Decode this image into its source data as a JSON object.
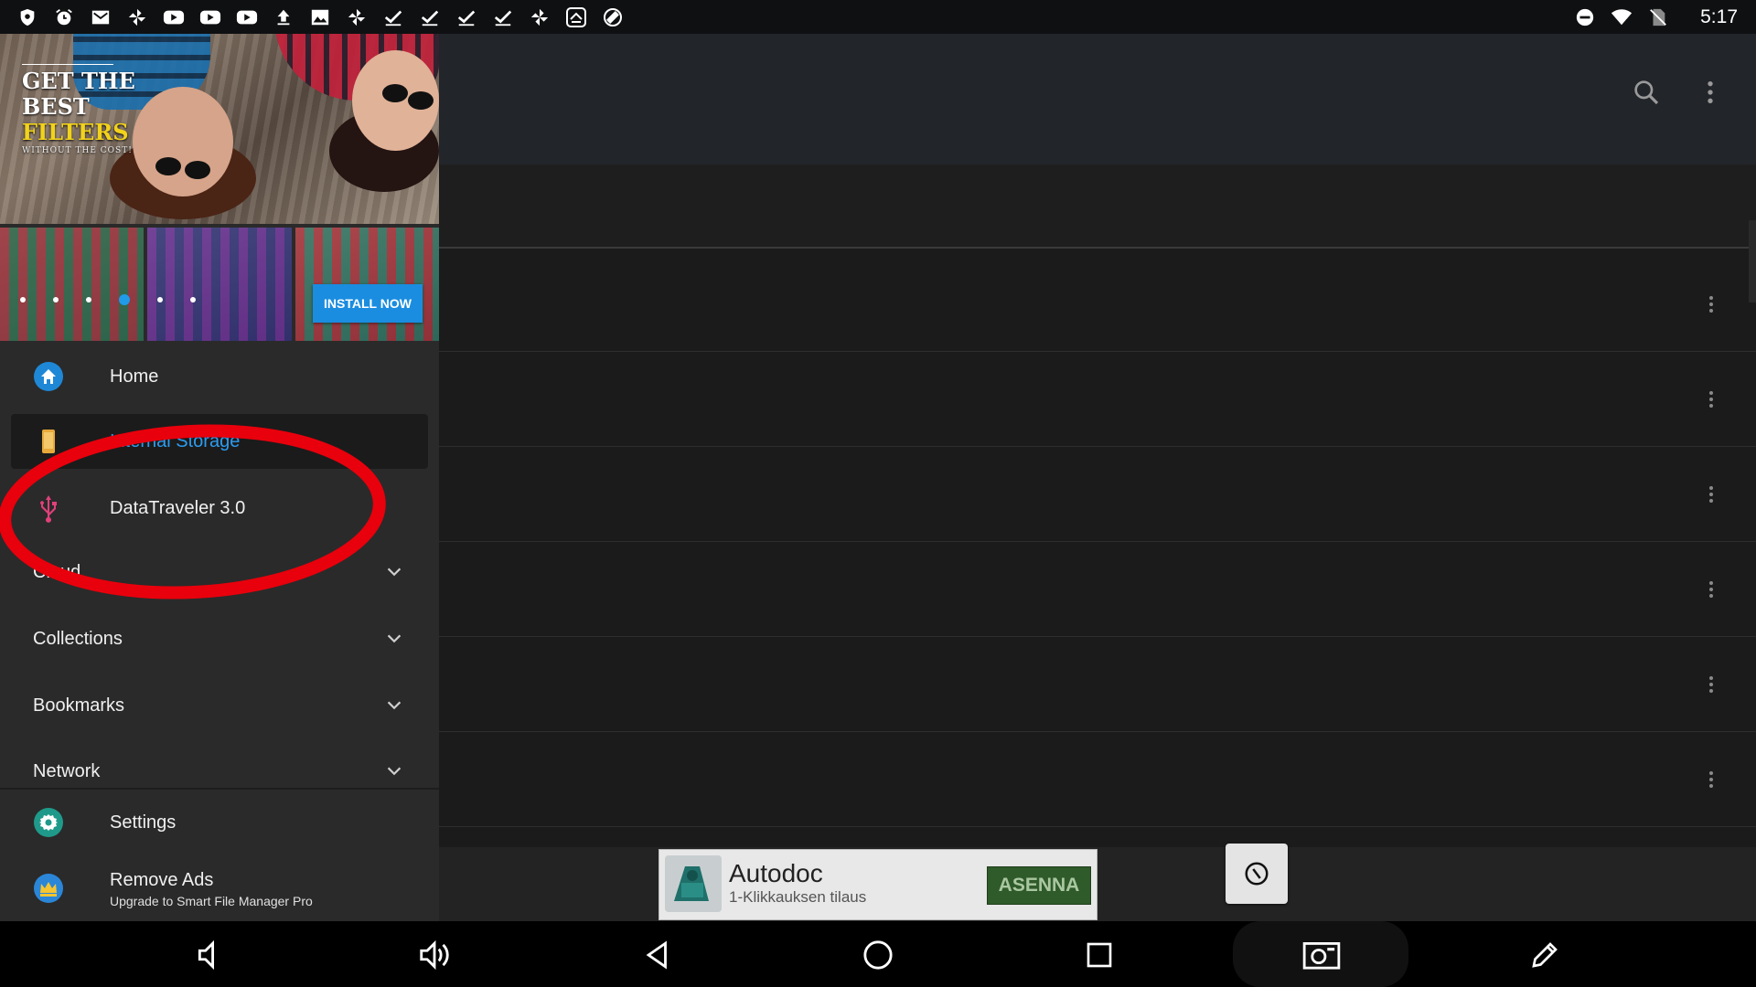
{
  "status_bar": {
    "time": "5:17",
    "left_icons": [
      "shield-icon",
      "alarm-icon",
      "mail-icon",
      "pinwheel-icon",
      "youtube-icon",
      "youtube-icon",
      "youtube-icon",
      "upload-icon",
      "image-icon",
      "pinwheel-icon",
      "check-icon",
      "check-icon",
      "check-icon",
      "check-icon",
      "pinwheel-icon",
      "scan-icon",
      "screen-rotation-icon"
    ],
    "right_icons": [
      "do-not-disturb-icon",
      "wifi-icon",
      "no-sim-icon"
    ]
  },
  "banner": {
    "headline_line1": "GET THE",
    "headline_line2": "BEST",
    "headline_line3": "FILTERS",
    "headline_sub": "WITHOUT THE COST!",
    "install_label": "INSTALL NOW",
    "carousel_dots": 6,
    "active_dot": 4
  },
  "drawer": {
    "items": [
      {
        "label": "Home",
        "icon": "home-icon"
      },
      {
        "label": "Internal Storage",
        "icon": "phone-storage-icon",
        "selected": true
      },
      {
        "label": "DataTraveler 3.0",
        "icon": "usb-icon"
      }
    ],
    "sections": [
      {
        "label": "Cloud"
      },
      {
        "label": "Collections"
      },
      {
        "label": "Bookmarks"
      },
      {
        "label": "Network"
      }
    ],
    "settings_label": "Settings",
    "remove_ads_title": "Remove Ads",
    "remove_ads_sub": "Upgrade to Smart File Manager Pro"
  },
  "ad": {
    "title": "Autodoc",
    "subtitle": "1-Klikkauksen tilaus",
    "button": "ASENNA"
  },
  "colors": {
    "accent_blue": "#2c9cf0",
    "install_blue": "#1a8de0",
    "usb_pink": "#e23f7b",
    "annotation_red": "#e8000c"
  }
}
